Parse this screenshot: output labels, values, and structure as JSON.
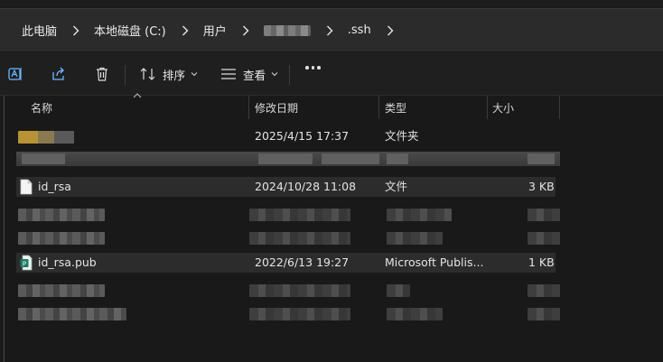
{
  "breadcrumb": {
    "items": [
      "此电脑",
      "本地磁盘 (C:)",
      "用户",
      "",
      ".ssh"
    ]
  },
  "toolbar": {
    "sort_label": "排序",
    "view_label": "查看"
  },
  "columns": {
    "name": "名称",
    "modified": "修改日期",
    "type": "类型",
    "size": "大小"
  },
  "files": [
    {
      "name": "",
      "modified": "2025/4/15 17:37",
      "type": "文件夹",
      "size": "",
      "icon": "folder-icon",
      "blurred_name": true
    },
    {
      "name": "id_rsa",
      "modified": "2024/10/28 11:08",
      "type": "文件",
      "size": "3 KB",
      "icon": "document-icon"
    },
    {
      "name": "id_rsa.pub",
      "modified": "2022/6/13 19:27",
      "type": "Microsoft Publis...",
      "size": "1 KB",
      "icon": "publisher-icon"
    }
  ],
  "colors": {
    "background": "#191919",
    "selected_row": "#2c2c2c",
    "publisher_icon": "#1f7a66",
    "folder": "#c9a13b"
  }
}
